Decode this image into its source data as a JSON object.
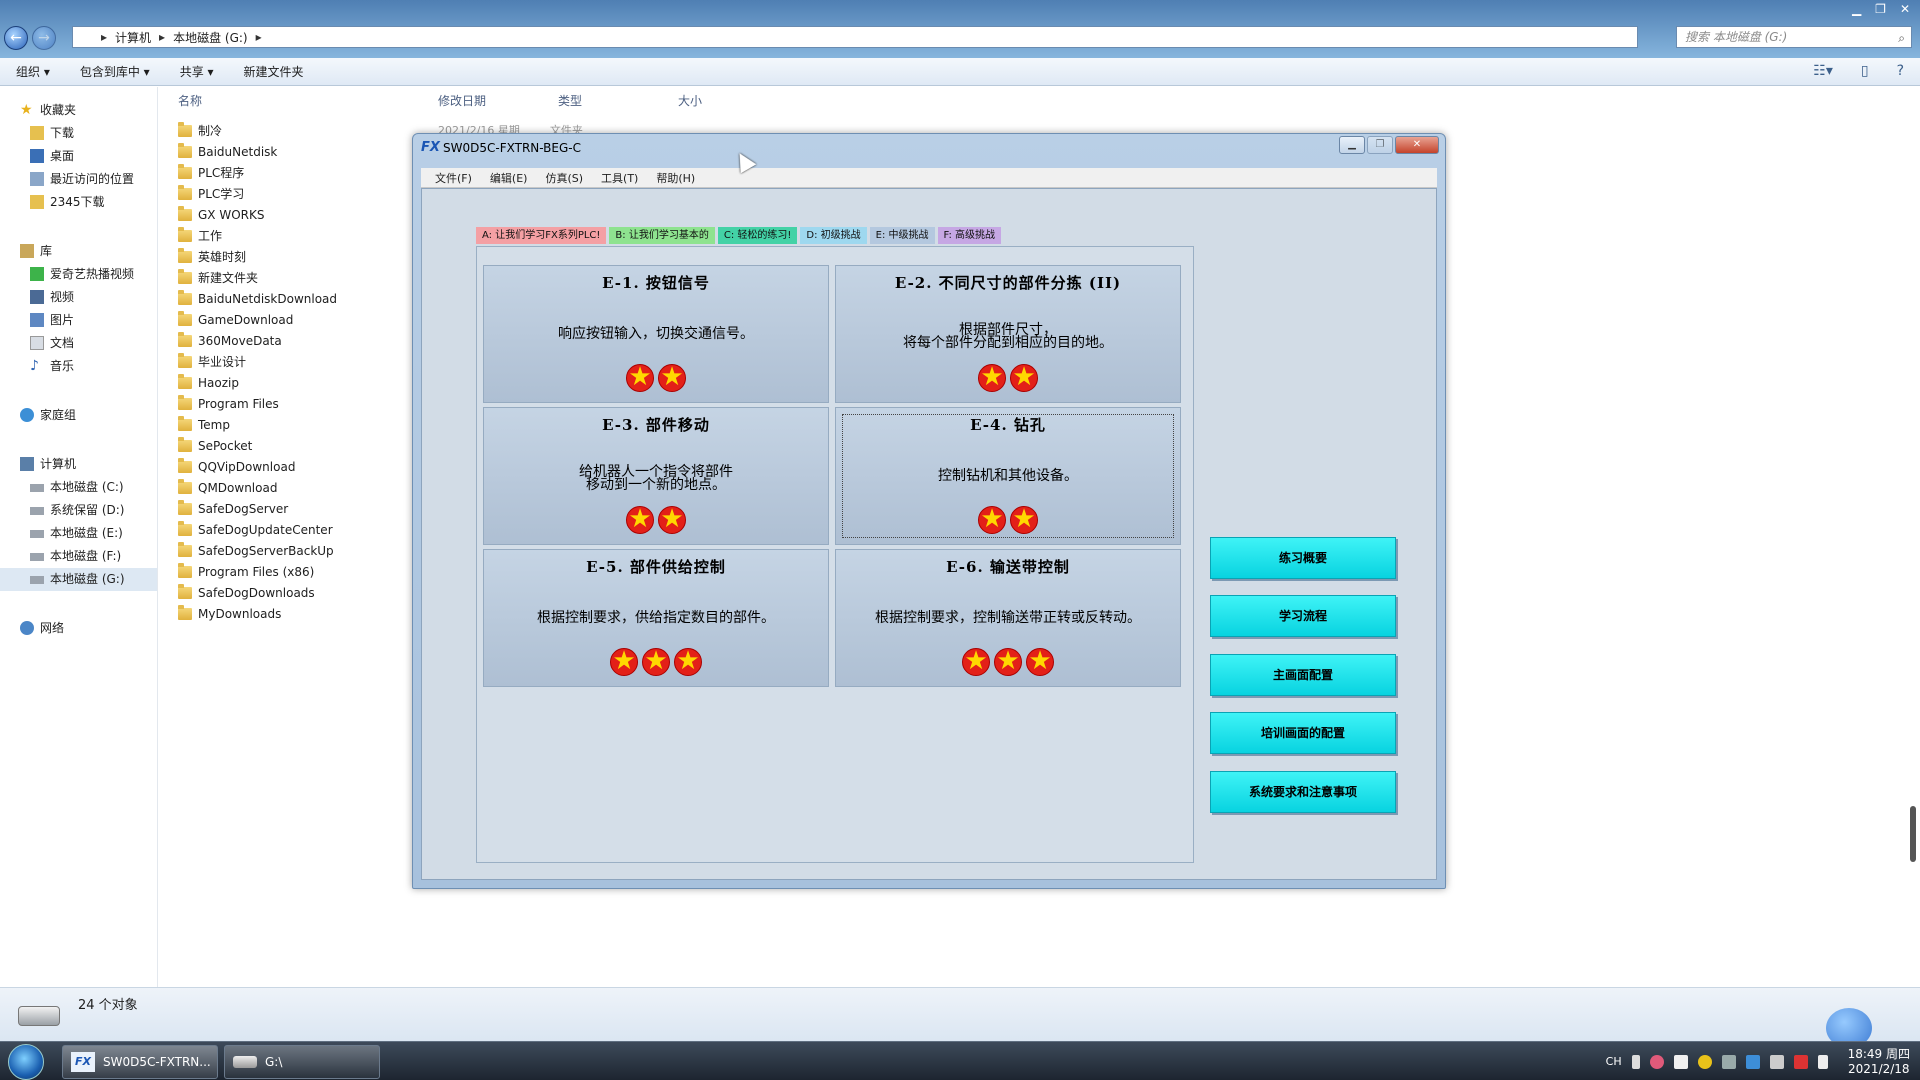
{
  "explorer": {
    "breadcrumb": [
      "计算机",
      "本地磁盘 (G:)"
    ],
    "search_placeholder": "搜索 本地磁盘 (G:)",
    "toolbar": {
      "organize": "组织 ▾",
      "include_library": "包含到库中 ▾",
      "share": "共享 ▾",
      "new_folder": "新建文件夹"
    },
    "nav": {
      "favorites": {
        "label": "收藏夹",
        "items": [
          "下载",
          "桌面",
          "最近访问的位置",
          "2345下载"
        ]
      },
      "libraries": {
        "label": "库",
        "items": [
          "爱奇艺热播视频",
          "视频",
          "图片",
          "文档",
          "音乐"
        ]
      },
      "homegroup": "家庭组",
      "computer": {
        "label": "计算机",
        "items": [
          "本地磁盘 (C:)",
          "系统保留 (D:)",
          "本地磁盘 (E:)",
          "本地磁盘 (F:)",
          "本地磁盘 (G:)"
        ]
      },
      "network": "网络"
    },
    "columns": {
      "name": "名称",
      "modified": "修改日期",
      "type": "类型",
      "size": "大小"
    },
    "ghost_row": {
      "date": "2021/2/16 星期",
      "type": "文件夹"
    },
    "files": [
      "制冷",
      "BaiduNetdisk",
      "PLC程序",
      "PLC学习",
      "GX WORKS",
      "工作",
      "英雄时刻",
      "新建文件夹",
      "BaiduNetdiskDownload",
      "GameDownload",
      "360MoveData",
      "毕业设计",
      "Haozip",
      "Program Files",
      "Temp",
      "SePocket",
      "QQVipDownload",
      "QMDownload",
      "SafeDogServer",
      "SafeDogUpdateCenter",
      "SafeDogServerBackUp",
      "Program Files (x86)",
      "SafeDogDownloads",
      "MyDownloads"
    ],
    "status": "24 个对象"
  },
  "app": {
    "title": "SW0D5C-FXTRN-BEG-C",
    "logo": "FX",
    "menu": [
      "文件(F)",
      "编辑(E)",
      "仿真(S)",
      "工具(T)",
      "帮助(H)"
    ],
    "tabs": [
      {
        "label": "A: 让我们学习FX系列PLC!",
        "color": "#f4a0a4"
      },
      {
        "label": "B: 让我们学习基本的",
        "color": "#8ee38f"
      },
      {
        "label": "C: 轻松的练习!",
        "color": "#43d2a6"
      },
      {
        "label": "D: 初级挑战",
        "color": "#9ed8ef"
      },
      {
        "label": "E: 中级挑战",
        "color": "#b4c8df"
      },
      {
        "label": "F: 高级挑战",
        "color": "#c6a7e4"
      }
    ],
    "active_tab": 4,
    "cards": [
      {
        "title": "E-1. 按钮信号",
        "desc": [
          "响应按钮输入，切换交通信号。"
        ],
        "stars": 2
      },
      {
        "title": "E-2. 不同尺寸的部件分拣 (II)",
        "desc": [
          "根据部件尺寸，",
          "将每个部件分配到相应的目的地。"
        ],
        "stars": 2
      },
      {
        "title": "E-3. 部件移动",
        "desc": [
          "给机器人一个指令将部件",
          "移动到一个新的地点。"
        ],
        "stars": 2
      },
      {
        "title": "E-4. 钻孔",
        "desc": [
          "控制钻机和其他设备。"
        ],
        "stars": 2
      },
      {
        "title": "E-5. 部件供给控制",
        "desc": [
          "根据控制要求，供给指定数目的部件。"
        ],
        "stars": 3
      },
      {
        "title": "E-6. 输送带控制",
        "desc": [
          "根据控制要求，控制输送带正转或反转动。"
        ],
        "stars": 3
      }
    ],
    "side_buttons": [
      "练习概要",
      "学习流程",
      "主画面配置",
      "培训画面的配置",
      "系统要求和注意事项"
    ]
  },
  "taskbar": {
    "tasks": [
      "SW0D5C-FXTRN...",
      "G:\\"
    ],
    "lang": "CH",
    "time": "18:49 周四",
    "date": "2021/2/18"
  }
}
